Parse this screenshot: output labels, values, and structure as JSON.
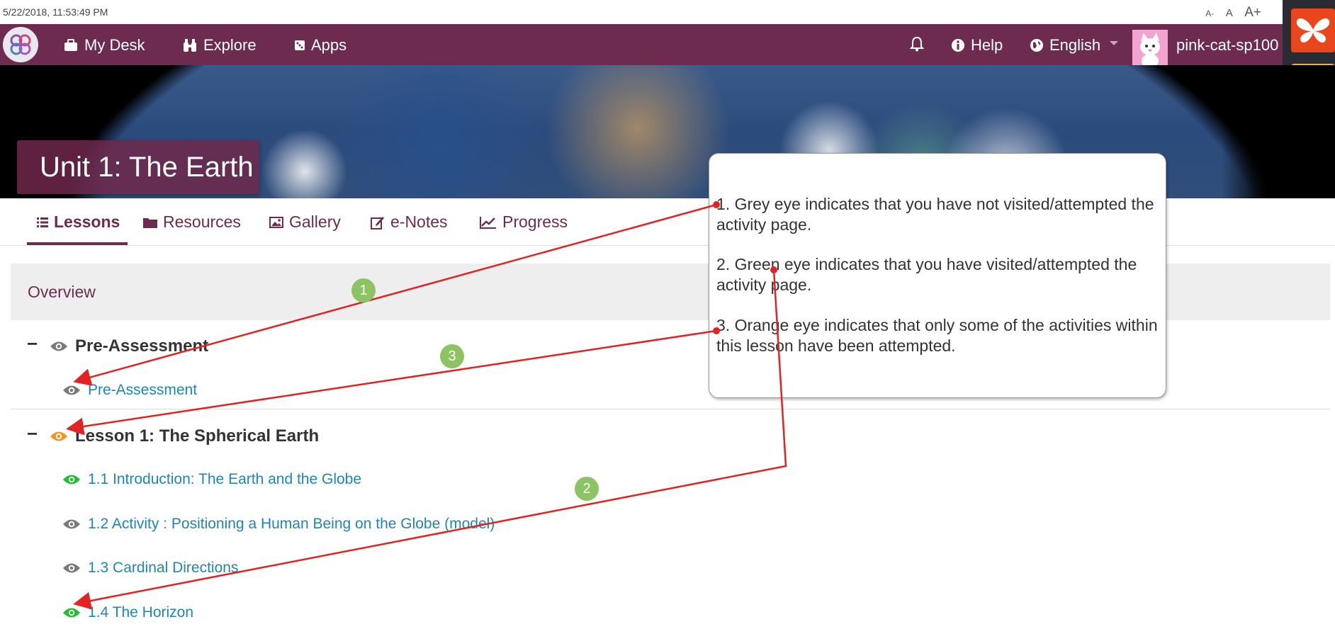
{
  "timestamp": "5/22/2018, 11:53:49 PM",
  "font_controls": {
    "small": "A-",
    "normal": "A",
    "large": "A+"
  },
  "nav": {
    "my_desk": "My Desk",
    "explore": "Explore",
    "apps": "Apps",
    "help": "Help",
    "language": "English",
    "username": "pink-cat-sp100"
  },
  "side_buttons": {
    "add": "+"
  },
  "unit": {
    "title": "Unit 1: The Earth"
  },
  "tabs": [
    {
      "label": "Lessons",
      "active": true
    },
    {
      "label": "Resources"
    },
    {
      "label": "Gallery"
    },
    {
      "label": "e-Notes"
    },
    {
      "label": "Progress"
    }
  ],
  "overview": {
    "label": "Overview"
  },
  "sections": [
    {
      "collapse": "−",
      "title": "Pre-Assessment",
      "eye_color": "#7a7a7a",
      "items": [
        {
          "label": "Pre-Assessment",
          "eye_color": "#7a7a7a"
        }
      ]
    },
    {
      "collapse": "−",
      "title": "Lesson 1: The Spherical Earth",
      "eye_color": "#f0961e",
      "items": [
        {
          "label": "1.1 Introduction: The Earth and the Globe",
          "eye_color": "#1fbf2f"
        },
        {
          "label": "1.2 Activity : Positioning a Human Being on the Globe (model)",
          "eye_color": "#7a7a7a"
        },
        {
          "label": "1.3 Cardinal Directions",
          "eye_color": "#7a7a7a"
        },
        {
          "label": "1.4 The Horizon",
          "eye_color": "#1fbf2f"
        }
      ]
    }
  ],
  "callout": {
    "line1": "1. Grey eye indicates that you have not visited/attempted the activity page.",
    "line2": "2. Green eye indicates that you have visited/attempted the activity page.",
    "line3": "3. Orange eye indicates that only some of the activities within this lesson have been attempted."
  },
  "badges": {
    "one": "1",
    "two": "2",
    "three": "3"
  },
  "colors": {
    "brand": "#6d2c4f",
    "link": "#1f86b3",
    "annotation": "#e32222",
    "badge": "#8cc464"
  }
}
